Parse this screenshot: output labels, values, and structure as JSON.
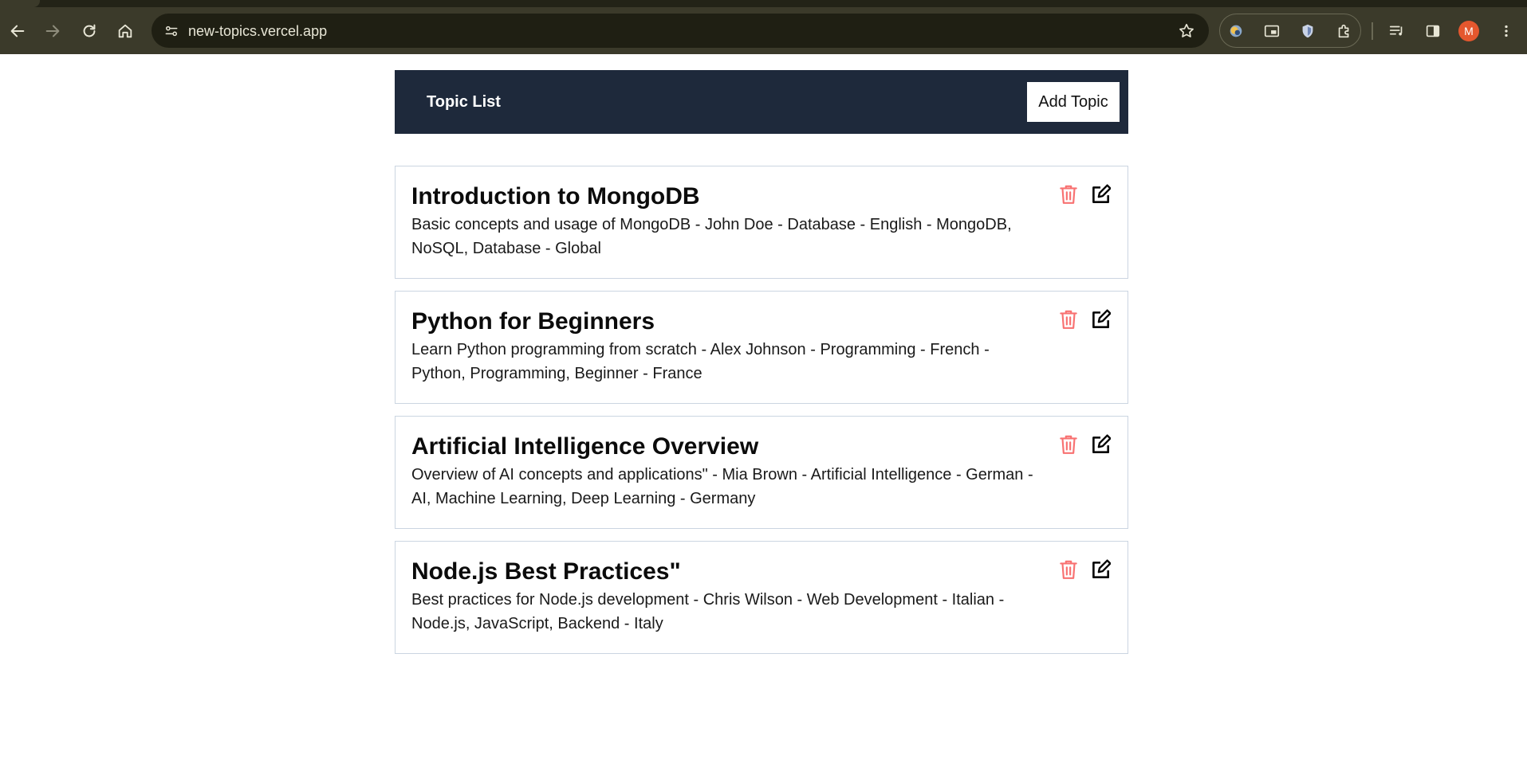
{
  "browser": {
    "url": "new-topics.vercel.app",
    "avatar_initial": "M",
    "icons": [
      "back-icon",
      "forward-icon",
      "reload-icon",
      "home-icon",
      "site-info-icon",
      "bookmark-star-icon",
      "extension-icon",
      "picture-in-picture-icon",
      "shield-icon",
      "puzzle-icon",
      "media-queue-icon",
      "side-panel-icon",
      "more-vert-icon"
    ],
    "colors": {
      "frame": "#3b3a2a",
      "omnibox": "#1f1f13",
      "avatar": "#e4572e"
    }
  },
  "navbar": {
    "brand": "Topic List",
    "add_button": "Add Topic",
    "background": "#1e293b"
  },
  "topics": [
    {
      "title": "Introduction to MongoDB",
      "description": "Basic concepts and usage of MongoDB - John Doe - Database - English - MongoDB, NoSQL, Database - Global"
    },
    {
      "title": "Python for Beginners",
      "description": "Learn Python programming from scratch - Alex Johnson - Programming - French - Python, Programming, Beginner - France"
    },
    {
      "title": "Artificial Intelligence Overview",
      "description": "Overview of AI concepts and applications\" - Mia Brown - Artificial Intelligence - German - AI, Machine Learning, Deep Learning - Germany"
    },
    {
      "title": "Node.js Best Practices\"",
      "description": "Best practices for Node.js development - Chris Wilson - Web Development - Italian - Node.js, JavaScript, Backend - Italy"
    }
  ],
  "actions": {
    "delete_icon": "trash-icon",
    "edit_icon": "edit-icon",
    "delete_color": "#f87171",
    "edit_color": "#000000"
  }
}
